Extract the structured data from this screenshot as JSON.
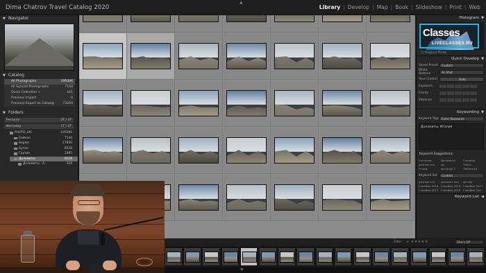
{
  "app": {
    "catalog_title": "Dima Chatrov Travel Catalog 2020",
    "modules": [
      "Library",
      "Develop",
      "Map",
      "Book",
      "Slideshow",
      "Print",
      "Web"
    ],
    "active_module": "Library"
  },
  "left_panel": {
    "navigator_label": "Navigator",
    "catalog_label": "Catalog",
    "catalog_items": [
      {
        "label": "All Photographs",
        "count": "195086"
      },
      {
        "label": "All Synced Photographs",
        "count": "7144"
      },
      {
        "label": "Quick Collection +",
        "count": "161"
      },
      {
        "label": "Previous Import",
        "count": "0"
      },
      {
        "label": "Previous Export as Catalog",
        "count": "73264"
      }
    ],
    "folders_label": "Folders",
    "folder_bars": [
      {
        "label": "Personal",
        "count": "3T / 3T"
      },
      {
        "label": "Фотомир",
        "count": "1T / 3T"
      }
    ],
    "folders": [
      {
        "label": "PHOTO_SKI",
        "count": "195086"
      },
      {
        "label": "Байкал",
        "count": "7144"
      },
      {
        "label": "Бирма",
        "count": "27850"
      },
      {
        "label": "Бутан",
        "count": "8528"
      },
      {
        "label": "Грузия",
        "count": "3365"
      },
      {
        "label": "Доломиты",
        "count": "6116"
      },
      {
        "label": "Доломиты - А...",
        "count": "329"
      }
    ]
  },
  "right_panel": {
    "histogram_label": "Histogram",
    "logo_main": "Classes",
    "logo_sub": "LIVECLASSES.RU",
    "original_photo": "Original Photo",
    "quick_develop_label": "Quick Develop",
    "saved_preset": {
      "label": "Saved Preset",
      "value": "Custom"
    },
    "white_balance": {
      "label": "White Balance",
      "value": "As Shot"
    },
    "tone_control": {
      "label": "Tone Control",
      "value": "Auto"
    },
    "tone_rows": [
      "Exposure",
      "Clarity",
      "Vibrance"
    ],
    "keywording_label": "Keywording",
    "keyword_tags": {
      "label": "Keyword Tags",
      "value": "Enter Keywords"
    },
    "keywords_text": "Доломиты, Италия",
    "keyword_suggestions_label": "Keyword Suggestions",
    "keyword_suggestions": [
      "Гостиная",
      "Доломиты",
      "Camping",
      "дачные сна",
      "дд",
      "Тирол",
      "Отзыв",
      "фотопро 2",
      "Лайфхаки"
    ],
    "keyword_set": {
      "label": "Keyword Set",
      "value": "Custom"
    },
    "keyword_set_items": [
      "дачные сна",
      "Доломит пак",
      "фотоф",
      "Гамейма 2018",
      "Гамейма 2019",
      "Гамейма 2017",
      "Гамейма 2017",
      "Гамейма 2015",
      "Гамейма Тип"
    ],
    "keyword_list_label": "Keyword List",
    "sync_metadata": "Sync Metadata",
    "sync_settings": "Sync Settings"
  },
  "filmstrip": {
    "filter_label": "Filter :",
    "filter_value": "Filters Off"
  },
  "colors": {
    "accent_logo": "#18b8e8",
    "grid_bg": "#8c8c8c",
    "panel_bg": "#262626"
  }
}
